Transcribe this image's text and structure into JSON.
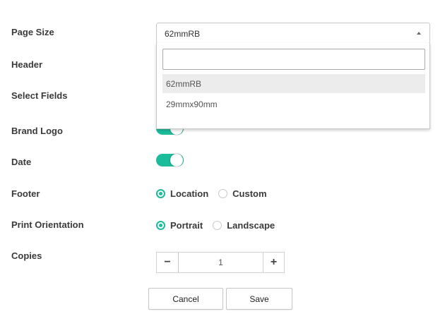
{
  "form": {
    "labels": {
      "page_size": "Page Size",
      "header": "Header",
      "select_fields": "Select Fields",
      "brand_logo": "Brand Logo",
      "date": "Date",
      "footer": "Footer",
      "print_orientation": "Print Orientation",
      "copies": "Copies"
    },
    "page_size": {
      "selected": "62mmRB",
      "search_value": "",
      "options": [
        "62mmRB",
        "29mmx90mm"
      ],
      "highlighted": "62mmRB",
      "open": true
    },
    "brand_logo": {
      "enabled": true
    },
    "date": {
      "enabled": true
    },
    "footer": {
      "options": [
        "Location",
        "Custom"
      ],
      "selected": "Location"
    },
    "print_orientation": {
      "options": [
        "Portrait",
        "Landscape"
      ],
      "selected": "Portrait"
    },
    "copies": {
      "value": "1",
      "minus_symbol": "−",
      "plus_symbol": "+"
    }
  },
  "actions": {
    "cancel_label": "Cancel",
    "save_label": "Save"
  },
  "colors": {
    "accent": "#1bbc9b",
    "border": "#c8c8c8",
    "highlight_bg": "#ececec"
  }
}
